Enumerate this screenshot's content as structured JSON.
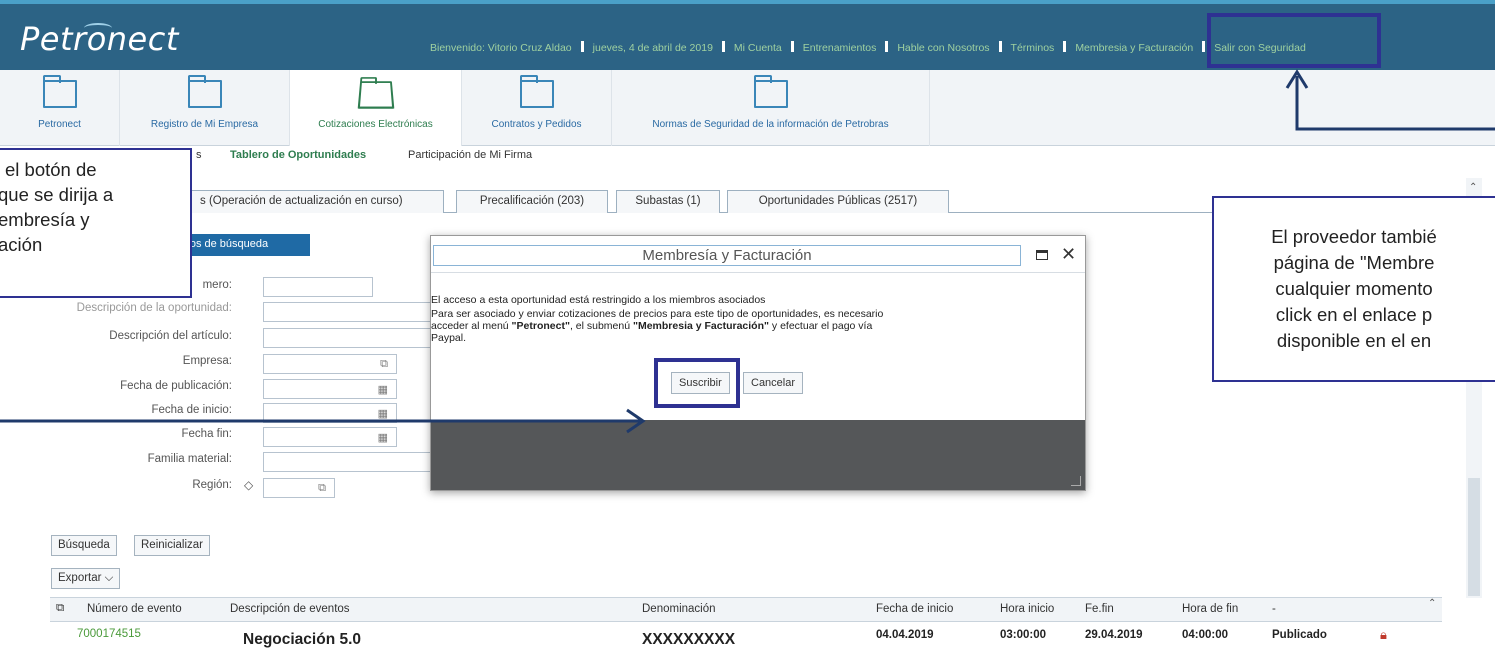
{
  "header": {
    "logo": "Petronect",
    "welcome": "Bienvenido: Vitorio Cruz Aldao",
    "date": "jueves, 4 de abril de 2019",
    "links": [
      "Mi Cuenta",
      "Entrenamientos",
      "Hable con Nosotros",
      "Términos",
      "Membresia y Facturación",
      "Salir con Seguridad"
    ]
  },
  "nav": {
    "items": [
      {
        "label": "Petronect"
      },
      {
        "label": "Registro de Mi Empresa"
      },
      {
        "label": "Cotizaciones Electrónicas"
      },
      {
        "label": "Contratos y Pedidos"
      },
      {
        "label": "Normas de Seguridad de la información de Petrobras"
      }
    ]
  },
  "subnav": {
    "partial": "s",
    "active": "Tablero de Oportunidades",
    "other": "Participación de Mi Firma"
  },
  "tabs": [
    "s (Operación de actualización en curso)",
    "Precalificación (203)",
    "Subastas (1)",
    "Oportunidades Públicas (2517)"
  ],
  "search": {
    "button": "etros de búsqueda",
    "fields": {
      "numero": "mero:",
      "descripcion_oportunidad": "Descripción de la oportunidad:",
      "descripcion_articulo": "Descripción del artículo:",
      "empresa": "Empresa:",
      "fecha_publicacion": "Fecha de publicación:",
      "fecha_inicio": "Fecha de inicio:",
      "fecha_fin": "Fecha fin:",
      "familia": "Familia material:",
      "region": "Región:"
    },
    "busqueda": "Búsqueda",
    "reinicializar": "Reinicializar",
    "exportar": "Exportar"
  },
  "table": {
    "headers": [
      "Número de evento",
      "Descripción de eventos",
      "Denominación",
      "Fecha de inicio",
      "Hora inicio",
      "Fe.fin",
      "Hora de fin",
      "-"
    ],
    "row": {
      "numero": "7000174515",
      "descripcion": "Negociación 5.0",
      "denominacion": "XXXXXXXXX",
      "fecha_inicio": "04.04.2019",
      "hora_inicio": "03:00:00",
      "fe_fin": "29.04.2019",
      "hora_fin": "04:00:00",
      "estado": "Publicado"
    }
  },
  "modal": {
    "title": "Membresía y Facturación",
    "line1": "El acceso a esta oportunidad está restringido a los miembros asociados",
    "line2_a": "Para ser asociado y enviar cotizaciones de precios para este tipo de oportunidades, es necesario",
    "line3_a": "acceder al menú ",
    "line3_b": "\"Petronect\"",
    "line3_c": ", el submenú ",
    "line3_d": "\"Membresia y Facturación\"",
    "line3_e": " y efectuar el pago vía",
    "line4": "Paypal.",
    "suscribir": "Suscribir",
    "cancelar": "Cancelar"
  },
  "callout_left": {
    "lines": [
      "el botón de",
      "que se dirija a",
      "embresía y",
      "ación"
    ]
  },
  "callout_right": {
    "lines": [
      "El proveedor tambié",
      "página de \"Membre",
      "cualquier momento",
      "click en el enlace p",
      "disponible en el en"
    ]
  },
  "colors": {
    "header_bg": "#2c6385",
    "accent_green": "#2e7d4f",
    "link_blue": "#2a6aa3",
    "highlight_box": "#2e3192"
  }
}
